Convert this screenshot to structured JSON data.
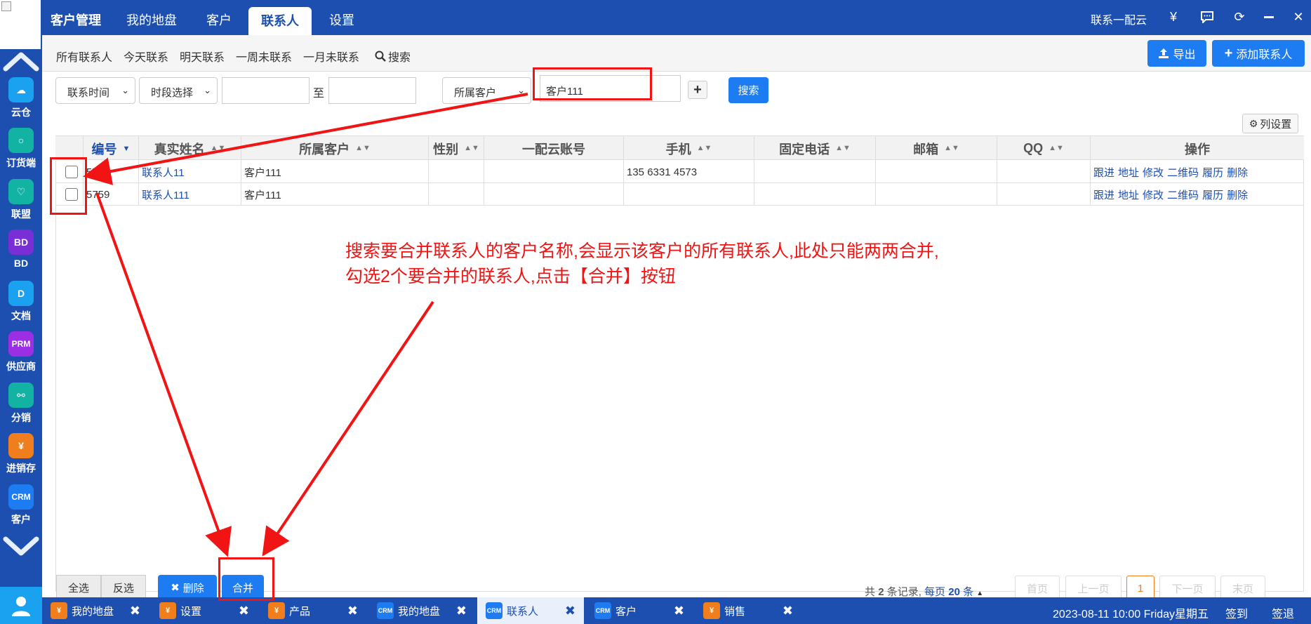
{
  "sidebar": {
    "items": [
      {
        "label": "云仓",
        "icon": "cloud-icon",
        "color": "#1aa1f0",
        "glyph": "☁"
      },
      {
        "label": "订货端",
        "icon": "chat-bubble-icon",
        "color": "#13b3a3",
        "glyph": "○"
      },
      {
        "label": "联盟",
        "icon": "handshake-icon",
        "color": "#13b3a3",
        "glyph": "♡"
      },
      {
        "label": "BD",
        "icon": "bd-icon",
        "color": "#7a2fd6",
        "glyph": "BD"
      },
      {
        "label": "文档",
        "icon": "document-icon",
        "color": "#1aa1f0",
        "glyph": "D"
      },
      {
        "label": "供应商",
        "icon": "prm-icon",
        "color": "#9b2fe3",
        "glyph": "PRM"
      },
      {
        "label": "分销",
        "icon": "distribution-tree-icon",
        "color": "#13b3a3",
        "glyph": "⚯"
      },
      {
        "label": "进销存",
        "icon": "yen-icon",
        "color": "#f07e1c",
        "glyph": "¥"
      },
      {
        "label": "客户",
        "icon": "crm-icon",
        "color": "#1e7cf2",
        "glyph": "CRM"
      }
    ]
  },
  "topbar": {
    "title": "客户管理",
    "nav": [
      "我的地盘",
      "客户",
      "联系人",
      "设置"
    ],
    "active_nav": "联系人",
    "right_text": "联系一配云",
    "icons": [
      "yen-icon",
      "message-icon",
      "refresh-icon",
      "minimize-icon",
      "close-icon"
    ]
  },
  "subnav": {
    "links": [
      "所有联系人",
      "今天联系",
      "明天联系",
      "一周未联系",
      "一月未联系"
    ],
    "search_label": "搜索",
    "export_label": "导出",
    "add_label": "添加联系人"
  },
  "filters": {
    "contact_time": "联系时间",
    "period": "时段选择",
    "to_label": "至",
    "customer_select": "所属客户",
    "customer_value": "客户111",
    "search_button": "搜索"
  },
  "table": {
    "column_settings": "列设置",
    "columns": [
      "编号",
      "真实姓名",
      "所属客户",
      "性别",
      "一配云账号",
      "手机",
      "固定电话",
      "邮箱",
      "QQ",
      "操作"
    ],
    "rows": [
      {
        "id": "5730",
        "name": "联系人11",
        "customer": "客户111",
        "gender": "",
        "account": "",
        "mobile": "135 6331 4573",
        "phone": "",
        "email": "",
        "qq": ""
      },
      {
        "id": "5759",
        "name": "联系人111",
        "customer": "客户111",
        "gender": "",
        "account": "",
        "mobile": "",
        "phone": "",
        "email": "",
        "qq": ""
      }
    ],
    "row_actions": [
      "跟进",
      "地址",
      "修改",
      "二维码",
      "履历",
      "删除"
    ]
  },
  "bottom": {
    "select_all": "全选",
    "invert": "反选",
    "delete": "删除",
    "merge": "合并",
    "total_prefix": "共",
    "total_count": "2",
    "total_suffix": "条记录,",
    "per_page_prefix": "每页",
    "per_page": "20",
    "per_page_suffix": "条",
    "first": "首页",
    "prev": "上一页",
    "page": "1",
    "next": "下一页",
    "last": "末页"
  },
  "taskbar": {
    "tabs": [
      {
        "label": "我的地盘",
        "badge": "¥",
        "color": "#f07e1c"
      },
      {
        "label": "设置",
        "badge": "¥",
        "color": "#f07e1c"
      },
      {
        "label": "产品",
        "badge": "¥",
        "color": "#f07e1c"
      },
      {
        "label": "我的地盘",
        "badge": "CRM",
        "color": "#1e7cf2"
      },
      {
        "label": "联系人",
        "badge": "CRM",
        "color": "#1e7cf2"
      },
      {
        "label": "客户",
        "badge": "CRM",
        "color": "#1e7cf2"
      },
      {
        "label": "销售",
        "badge": "¥",
        "color": "#f07e1c"
      }
    ],
    "active_tab": 4,
    "datetime": "2023-08-11 10:00 Friday星期五",
    "sign_in": "签到",
    "sign_out": "签退"
  },
  "annotation": {
    "line1": "搜索要合并联系人的客户名称,会显示该客户的所有联系人,此处只能两两合并,",
    "line2": "勾选2个要合并的联系人,点击【合并】按钮",
    "color": "#f01414"
  }
}
